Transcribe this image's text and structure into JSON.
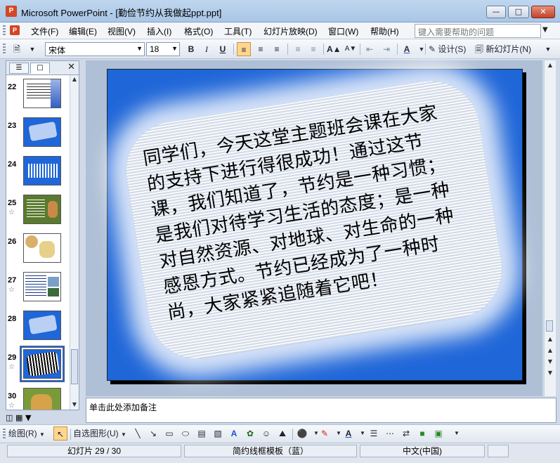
{
  "window": {
    "title": "Microsoft PowerPoint - [勤俭节约从我做起ppt.ppt]",
    "app_icon_label": "P"
  },
  "menubar": {
    "items": [
      "文件(F)",
      "编辑(E)",
      "视图(V)",
      "插入(I)",
      "格式(O)",
      "工具(T)",
      "幻灯片放映(D)",
      "窗口(W)",
      "帮助(H)"
    ],
    "help_placeholder": "键入需要帮助的问题"
  },
  "toolbar": {
    "font_name": "宋体",
    "font_size": "18",
    "bold": "B",
    "italic": "I",
    "underline": "U",
    "design_label": "设计(S)",
    "new_slide_label": "新幻灯片(N)"
  },
  "thumbnails": [
    {
      "num": "22",
      "star": ""
    },
    {
      "num": "23",
      "star": ""
    },
    {
      "num": "24",
      "star": ""
    },
    {
      "num": "25",
      "star": "☆"
    },
    {
      "num": "26",
      "star": ""
    },
    {
      "num": "27",
      "star": "☆"
    },
    {
      "num": "28",
      "star": ""
    },
    {
      "num": "29",
      "star": "☆"
    },
    {
      "num": "30",
      "star": "☆"
    }
  ],
  "slide": {
    "lines": [
      "同学们，今天这堂主题班会课在大家",
      "的支持下进行得很成功！通过这节",
      "课，我们知道了，节约是一种习惯；",
      "是我们对待学习生活的态度；是一种",
      "对自然资源、对地球、对生命的一种",
      "感恩方式。节约已经成为了一种时",
      "尚，大家紧紧追随着它吧！"
    ]
  },
  "notes_placeholder": "单击此处添加备注",
  "drawbar": {
    "draw_label": "绘图(R)",
    "autoshape_label": "自选图形(U)"
  },
  "status": {
    "slide_pos": "幻灯片 29 / 30",
    "template": "简约线框模板（蓝）",
    "language": "中文(中国)"
  }
}
